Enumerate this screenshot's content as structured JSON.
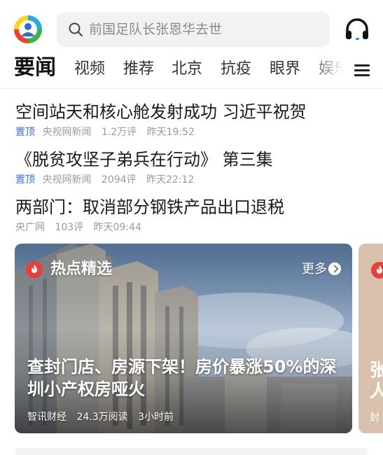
{
  "search": {
    "placeholder": "前国足队长张恩华去世"
  },
  "tabs": [
    {
      "label": "要闻",
      "active": true
    },
    {
      "label": "视频"
    },
    {
      "label": "推荐"
    },
    {
      "label": "北京"
    },
    {
      "label": "抗疫"
    },
    {
      "label": "眼界"
    },
    {
      "label": "娱乐"
    }
  ],
  "news": [
    {
      "title": "空间站天和核心舱发射成功 习近平祝贺",
      "pinned": "置顶",
      "source": "央视网新闻",
      "comments": "1.2万评",
      "time": "昨天19:52"
    },
    {
      "title": "《脱贫攻坚子弟兵在行动》 第三集",
      "pinned": "置顶",
      "source": "央视网新闻",
      "comments": "2094评",
      "time": "昨天22:12"
    },
    {
      "title": "两部门：取消部分钢铁产品出口退税",
      "pinned": "",
      "source": "央广网",
      "comments": "103评",
      "time": "昨天09:44"
    }
  ],
  "featured": {
    "section_title": "热点精选",
    "more_label": "更多",
    "headline": "查封门店、房源下架！房价暴涨50%的深圳小产权房哑火",
    "source": "智讯财经",
    "reads": "24.3万阅读",
    "time": "3小时前"
  },
  "next_card": {
    "title_fragment": "张\n人",
    "meta_fragment": "封"
  },
  "colors": {
    "accent_red": "#e5403a",
    "pin_blue": "#3d6fd4"
  }
}
